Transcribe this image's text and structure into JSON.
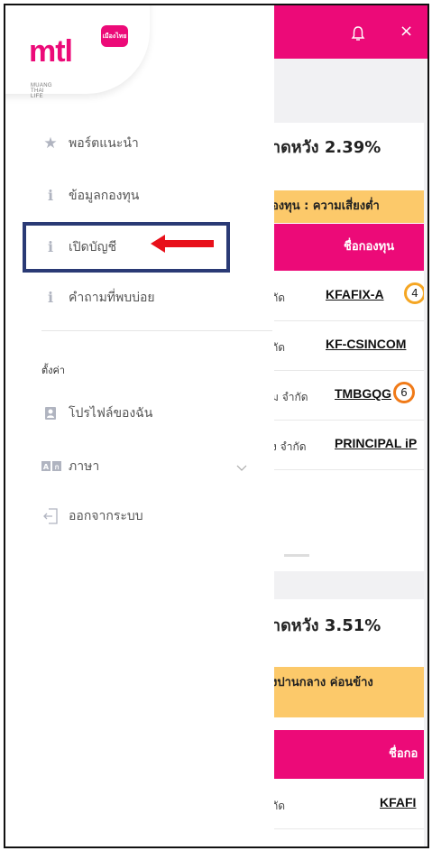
{
  "app": {
    "brand": "mtl",
    "brand_badge": "เมืองไทย",
    "brand_subtitle": "MUANG THAI LIFE"
  },
  "header": {
    "bell_icon": "bell-icon",
    "close_label": "×",
    "color": "#ec0a78"
  },
  "drawer": {
    "menu": [
      {
        "icon": "star-icon",
        "label": "พอร์ตแนะนำ"
      },
      {
        "icon": "info-icon",
        "label": "ข้อมูลกองทุน"
      },
      {
        "icon": "info-icon",
        "label": "เปิดบัญชี"
      },
      {
        "icon": "info-icon",
        "label": "คำถามที่พบบ่อย"
      }
    ],
    "settings_label": "ตั้งค่า",
    "settings": [
      {
        "icon": "profile-icon",
        "label": "โปรไฟล์ของฉัน"
      },
      {
        "icon": "language-icon",
        "label": "ภาษา"
      },
      {
        "icon": "logout-icon",
        "label": "ออกจากระบบ"
      }
    ]
  },
  "cards": [
    {
      "title": "าดหวัง 2.39%",
      "risk": "องทุน : ความเสี่ยงต่ำ",
      "header": "ชื่อกองทุน",
      "rows": [
        {
          "company": "กัด",
          "code": "KFAFIX-A",
          "risk": "4"
        },
        {
          "company": "กัด",
          "code": "KF-CSINCOM",
          "risk": ""
        },
        {
          "company": "ม จำกัด",
          "code": "TMBGQG",
          "risk": "6"
        },
        {
          "company": "ง จำกัด",
          "code": "PRINCIPAL iP",
          "risk": ""
        }
      ]
    },
    {
      "title": "าดหวัง 3.51%",
      "risk": "งปานกลาง ค่อนข้าง",
      "header": "ชื่อกอ",
      "rows": [
        {
          "company": "กัด",
          "code": "KFAFI",
          "risk": ""
        }
      ]
    }
  ],
  "annotation": {
    "highlight_color": "#2a3a75",
    "arrow_color": "#e8101a"
  }
}
